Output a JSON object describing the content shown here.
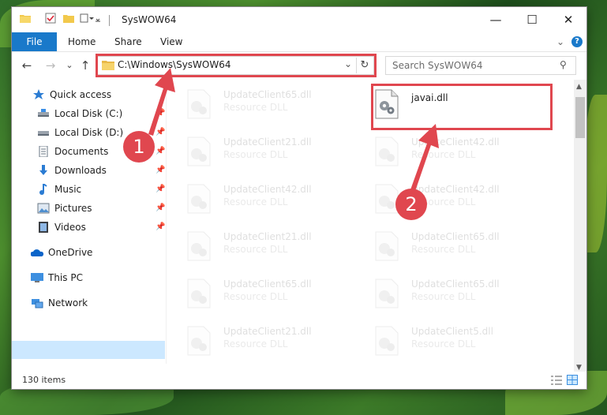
{
  "window": {
    "title": "SysWOW64",
    "minimize_glyph": "—",
    "maximize_glyph": "☐",
    "close_glyph": "✕"
  },
  "ribbon": {
    "tabs": [
      "File",
      "Home",
      "Share",
      "View"
    ],
    "expand_glyph": "⌄",
    "help_glyph": "?"
  },
  "navigation": {
    "back_glyph": "←",
    "forward_glyph": "→",
    "recent_glyph": "⌄",
    "up_glyph": "↑",
    "address": "C:\\Windows\\SysWOW64",
    "address_dropdown_glyph": "⌄",
    "refresh_glyph": "↻",
    "search_placeholder": "Search SysWOW64",
    "search_glyph": "⚲"
  },
  "sidebar": {
    "items": [
      {
        "label": "Quick access",
        "icon": "star-icon",
        "pinned": false
      },
      {
        "label": "Local Disk (C:)",
        "icon": "drive-icon",
        "pinned": true
      },
      {
        "label": "Local Disk (D:)",
        "icon": "drive-icon",
        "pinned": true
      },
      {
        "label": "Documents",
        "icon": "documents-icon",
        "pinned": true
      },
      {
        "label": "Downloads",
        "icon": "downloads-icon",
        "pinned": true
      },
      {
        "label": "Music",
        "icon": "music-icon",
        "pinned": true
      },
      {
        "label": "Pictures",
        "icon": "pictures-icon",
        "pinned": true
      },
      {
        "label": "Videos",
        "icon": "videos-icon",
        "pinned": true
      },
      {
        "label": "OneDrive",
        "icon": "onedrive-icon",
        "pinned": false
      },
      {
        "label": "This PC",
        "icon": "computer-icon",
        "pinned": false,
        "selected": true
      },
      {
        "label": "Network",
        "icon": "network-icon",
        "pinned": false
      }
    ],
    "pin_glyph": "📌"
  },
  "files": {
    "highlighted": {
      "name": "javai.dll",
      "type": ""
    },
    "left_column": [
      {
        "name": "UpdateClient65.dll",
        "type": "Resource DLL"
      },
      {
        "name": "UpdateClient21.dll",
        "type": "Resource DLL"
      },
      {
        "name": "UpdateClient42.dll",
        "type": "Resource DLL"
      },
      {
        "name": "UpdateClient21.dll",
        "type": "Resource DLL"
      },
      {
        "name": "UpdateClient65.dll",
        "type": "Resource DLL"
      },
      {
        "name": "UpdateClient21.dll",
        "type": "Resource DLL"
      }
    ],
    "right_column": [
      {
        "name": "UpdateClient42.dll",
        "type": "Resource DLL"
      },
      {
        "name": "UpdateClient42.dll",
        "type": "Resource DLL"
      },
      {
        "name": "UpdateClient65.dll",
        "type": "Resource DLL"
      },
      {
        "name": "UpdateClient65.dll",
        "type": "Resource DLL"
      },
      {
        "name": "UpdateClient5.dll",
        "type": "Resource DLL"
      }
    ]
  },
  "status": {
    "item_count": "130 items"
  },
  "annotations": {
    "step1": "1",
    "step2": "2",
    "color": "#e0474f"
  }
}
